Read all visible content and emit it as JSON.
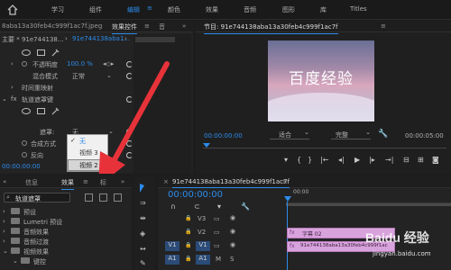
{
  "workspace_tabs": [
    {
      "label": "学习"
    },
    {
      "label": "组件"
    },
    {
      "label": "编辑"
    },
    {
      "label": "颜色"
    },
    {
      "label": "效果"
    },
    {
      "label": "音频"
    },
    {
      "label": "图形"
    },
    {
      "label": "库"
    },
    {
      "label": "Titles"
    }
  ],
  "source": {
    "file_label": "8aba13a30feb4c999f1ac7f.jpeg",
    "tab_effect_controls": "效果控件",
    "tab_other": "音",
    "master_label": "主要 * 91e744138...",
    "clip_label": "91e744138aba1...",
    "opacity_label": "不透明度",
    "opacity_value": "100.0 %",
    "blend_label": "混合模式",
    "blend_value": "正常",
    "time_remap_label": "时间重映射",
    "track_matte_label": "轨道遮罩键",
    "matte_label": "遮罩:",
    "matte_value": "无",
    "composite_label": "合成方式",
    "reverse_label": "反向",
    "timecode": "00:00:00:00",
    "dropdown": {
      "items": [
        "无",
        "视频 3",
        "视频 2"
      ]
    }
  },
  "program": {
    "title": "节目: 91e744138aba13a30feb4c999f1ac7f",
    "preview_text": "百度经验",
    "timecode_left": "00:00:00:00",
    "fit_value": "适合",
    "quality_value": "完整",
    "timecode_right": "00:00:05:00"
  },
  "project": {
    "tab_info": "信息",
    "tab_effects": "效果",
    "tab_markers": "标",
    "search_value": "轨道遮罩",
    "tree": [
      "预设",
      "Lumetri 预设",
      "音频效果",
      "音频过渡",
      "视频效果",
      "键控"
    ]
  },
  "timeline": {
    "title": "91e744138aba13a30feb4c999f1ac7f",
    "timecode": "00:00:00:00",
    "ruler_time": "00:00",
    "tracks": [
      {
        "name": "V3"
      },
      {
        "name": "V2"
      },
      {
        "name": "V1",
        "source": "V1"
      },
      {
        "name": "A1",
        "source": "A1"
      }
    ],
    "clips": [
      {
        "label": "字幕 02"
      },
      {
        "label": "91e744138aba13a30feb4c999f1ac"
      }
    ]
  },
  "watermark": {
    "text": "Baidu 经验",
    "url": "jingyan.baidu.com"
  },
  "colors": {
    "accent": "#2d8ceb",
    "clip_pink": "#d8a3dc",
    "arrow": "#e8323a"
  }
}
